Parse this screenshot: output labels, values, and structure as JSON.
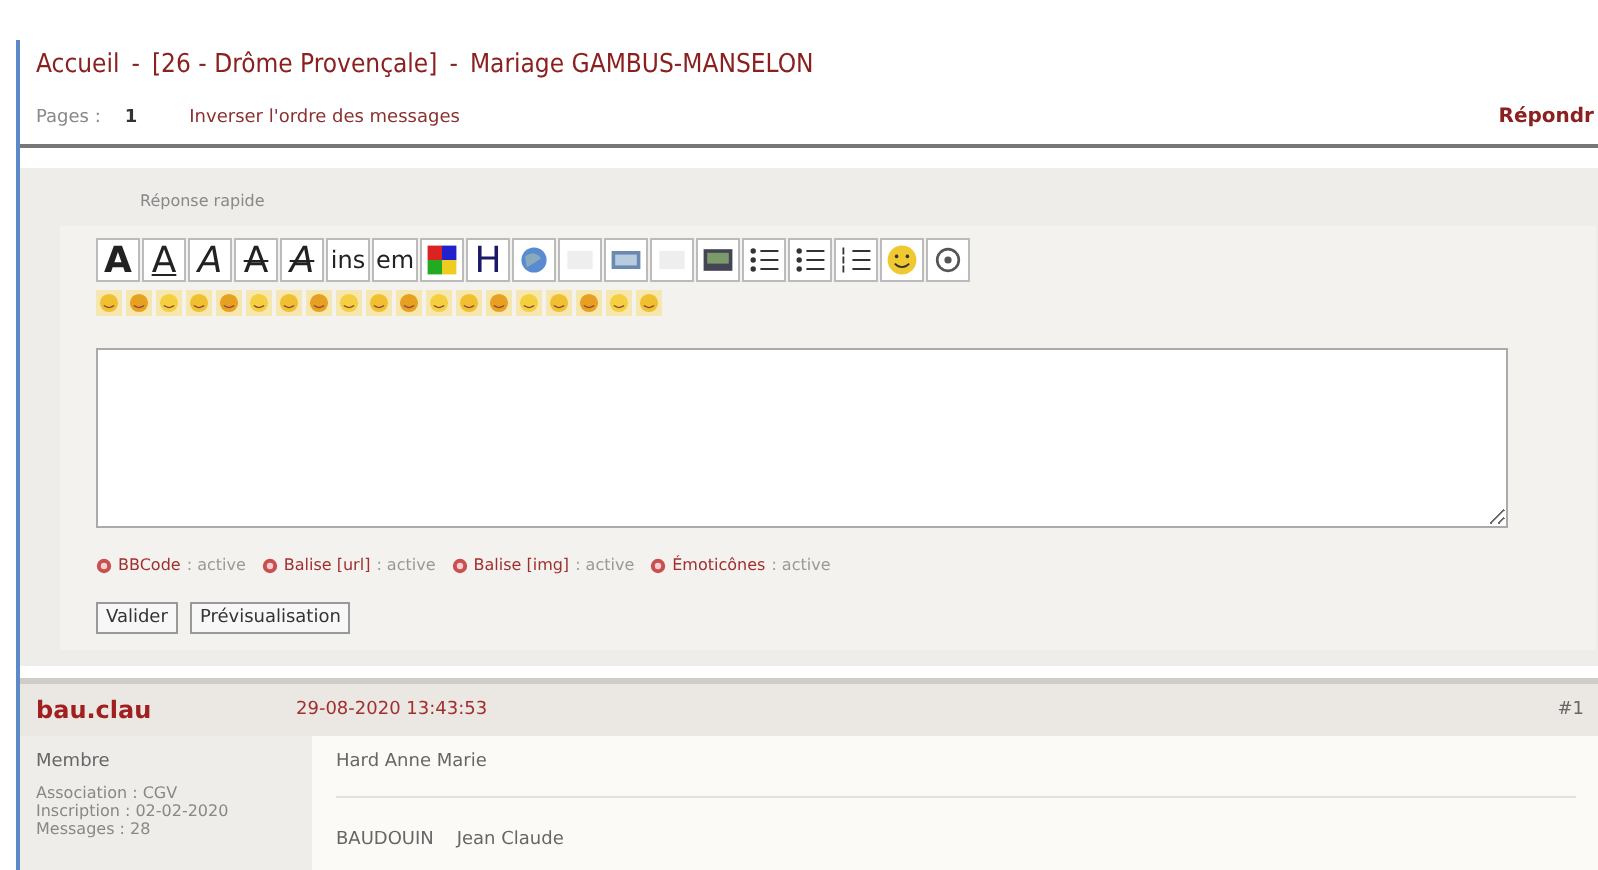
{
  "breadcrumb": {
    "home": "Accueil",
    "forum": "[26 - Drôme Provençale]",
    "topic": "Mariage GAMBUS-MANSELON",
    "separator": "-"
  },
  "pagination": {
    "label": "Pages :",
    "pages": [
      {
        "label": "1",
        "selected": true
      }
    ],
    "reverse_link": "Inverser l'ordre des messages",
    "reply_link": "Répondr"
  },
  "quick_reply": {
    "title": "Réponse rapide",
    "toolbar": [
      {
        "kind": "text",
        "label": "A"
      },
      {
        "kind": "text",
        "label": "A"
      },
      {
        "kind": "text",
        "label": "A"
      },
      {
        "kind": "text",
        "label": "A"
      },
      {
        "kind": "text",
        "label": "A"
      },
      {
        "kind": "text",
        "label": "ins"
      },
      {
        "kind": "text",
        "label": "em"
      },
      {
        "kind": "color"
      },
      {
        "kind": "text",
        "label": "H"
      },
      {
        "kind": "globe"
      },
      {
        "kind": "blank"
      },
      {
        "kind": "image"
      },
      {
        "kind": "blank"
      },
      {
        "kind": "photo"
      },
      {
        "kind": "list"
      },
      {
        "kind": "list"
      },
      {
        "kind": "numbered"
      },
      {
        "kind": "smiley"
      },
      {
        "kind": "help"
      }
    ],
    "options": [
      {
        "label": "BBCode",
        "status": ": active"
      },
      {
        "label": "Balise [url]",
        "status": ": active"
      },
      {
        "label": "Balise [img]",
        "status": ": active"
      },
      {
        "label": "Émoticônes",
        "status": ": active"
      }
    ],
    "buttons": [
      "Valider",
      "Prévisualisation"
    ]
  },
  "post": {
    "author": "bau.clau",
    "date": "29-08-2020 13:43:53",
    "number": "#1",
    "role": "Membre",
    "info": [
      "Association : CGV",
      "Inscription : 02-02-2020",
      "Messages : 28"
    ],
    "lines": [
      "Hard Anne Marie",
      "BAUDOUIN    Jean Claude"
    ]
  }
}
